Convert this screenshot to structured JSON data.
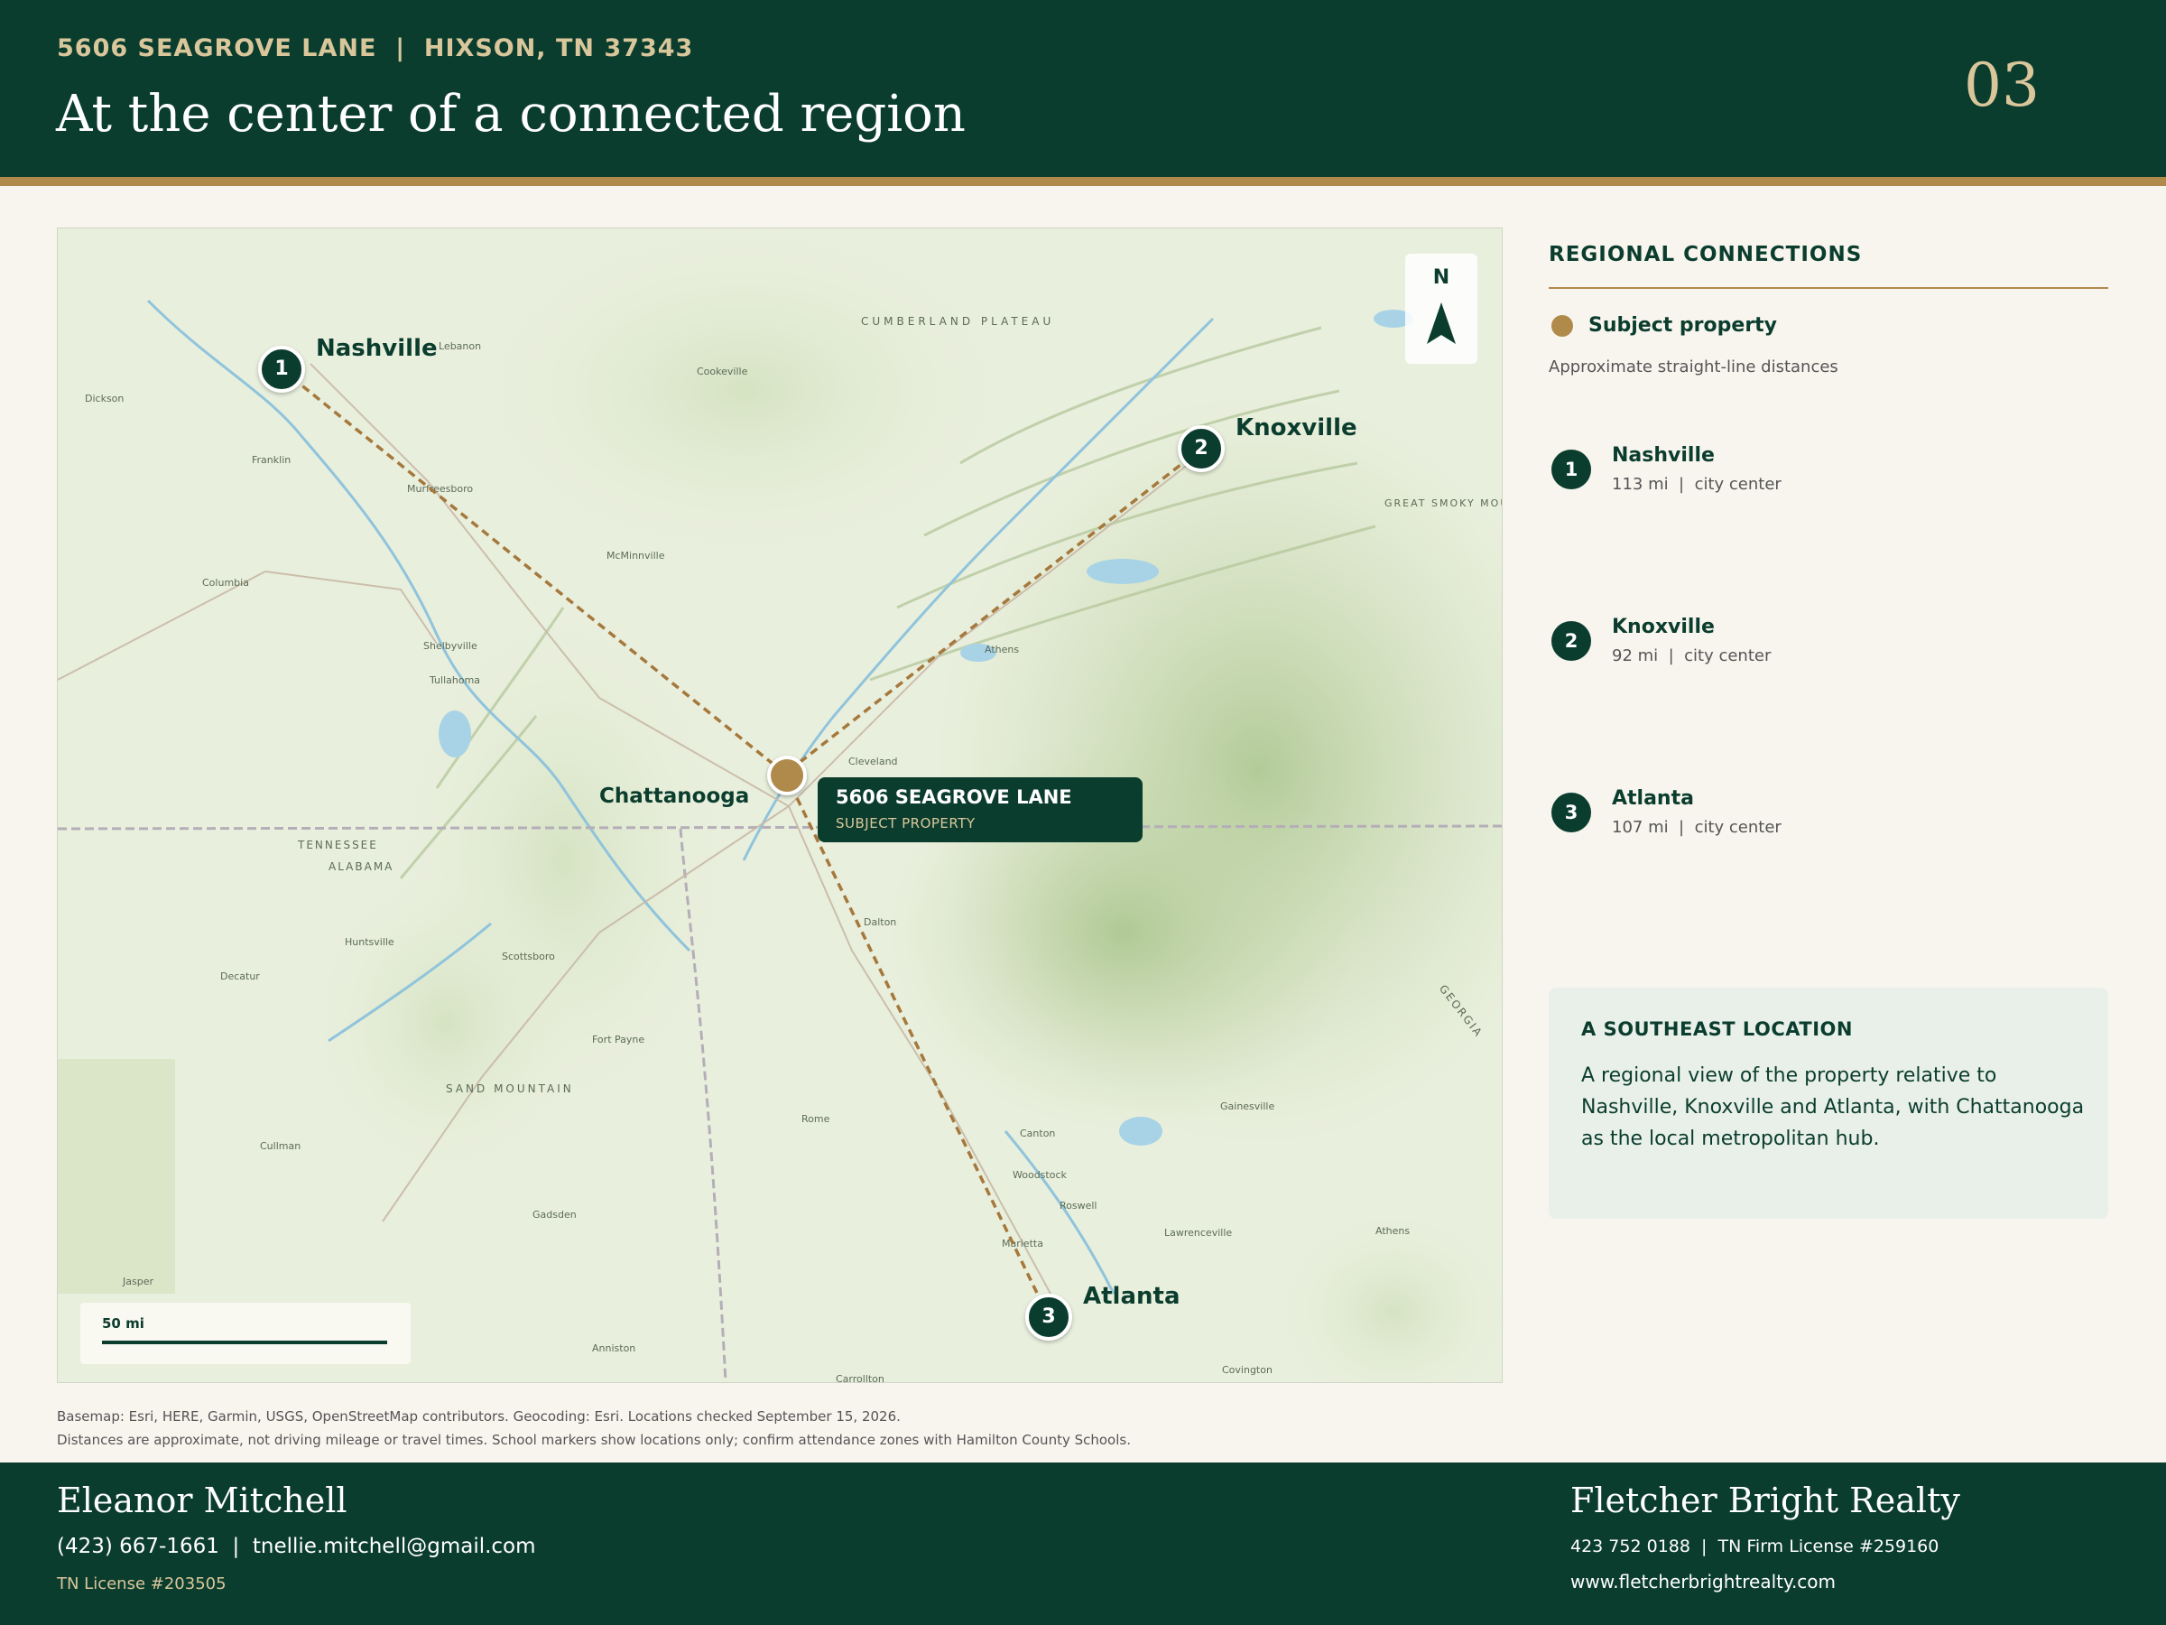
{
  "header": {
    "address": "5606 SEAGROVE LANE  |  HIXSON, TN 37343",
    "title": "At the center of a connected region",
    "page_number": "03"
  },
  "map": {
    "compass_label": "N",
    "scale_label": "50 mi",
    "subject": {
      "city_label": "Chattanooga",
      "callout_title": "5606 SEAGROVE LANE",
      "callout_subtitle": "SUBJECT PROPERTY"
    },
    "cities": [
      {
        "number": "1",
        "name": "Nashville"
      },
      {
        "number": "2",
        "name": "Knoxville"
      },
      {
        "number": "3",
        "name": "Atlanta"
      }
    ],
    "basemap_labels": {
      "tennessee": "TENNESSEE",
      "alabama": "ALABAMA",
      "georgia": "GEORGIA",
      "cumberland_plateau": "CUMBERLAND PLATEAU",
      "sand_mountain": "SAND MOUNTAIN",
      "great_smoky_mountains": "GREAT SMOKY MOUNTAINS",
      "cleveland": "Cleveland",
      "dalton": "Dalton",
      "rome": "Rome",
      "gadsden": "Gadsden",
      "huntsville": "Huntsville",
      "decatur": "Decatur",
      "murfreesboro": "Murfreesboro",
      "franklin": "Franklin",
      "columbia": "Columbia",
      "cookeville": "Cookeville",
      "athens": "Athens",
      "mcminnville": "McMinnville",
      "shelbyville": "Shelbyville",
      "tullahoma": "Tullahoma",
      "scottsboro": "Scottsboro",
      "fort_payne": "Fort Payne",
      "marietta": "Marietta",
      "canton": "Canton",
      "gainesville": "Gainesville",
      "lawrenceville": "Lawrenceville",
      "dickson": "Dickson",
      "lebanon": "Lebanon",
      "cullman": "Cullman",
      "anniston": "Anniston",
      "carrollton": "Carrollton",
      "covington": "Covington",
      "woodstock": "Woodstock",
      "roswell": "Roswell",
      "jasper": "Jasper",
      "athens_ga": "Athens"
    }
  },
  "credits": {
    "line1": "Basemap: Esri, HERE, Garmin, USGS, OpenStreetMap contributors. Geocoding: Esri. Locations checked September 15, 2026.",
    "line2": "Distances are approximate, not driving mileage or travel times. School markers show locations only; confirm attendance zones with Hamilton County Schools."
  },
  "panel": {
    "heading": "REGIONAL CONNECTIONS",
    "legend_label": "Subject property",
    "legend_note": "Approximate straight-line distances",
    "destinations": [
      {
        "number": "1",
        "name": "Nashville",
        "detail": "113 mi  |  city center"
      },
      {
        "number": "2",
        "name": "Knoxville",
        "detail": "92 mi  |  city center"
      },
      {
        "number": "3",
        "name": "Atlanta",
        "detail": "107 mi  |  city center"
      }
    ],
    "info": {
      "title": "A SOUTHEAST LOCATION",
      "body": "A regional view of the property relative to Nashville, Knoxville and Atlanta, with Chattanooga as the local metropolitan hub."
    }
  },
  "footer": {
    "agent_name": "Eleanor Mitchell",
    "agent_contact": "(423) 667-1661  |  tnellie.mitchell@gmail.com",
    "agent_license": "TN License #203505",
    "brokerage": "Fletcher Bright Realty",
    "brokerage_line": "423 752 0188  |  TN Firm License #259160",
    "brokerage_web": "www.fletcherbrightrealty.com"
  },
  "colors": {
    "brand_green": "#0b3d2e",
    "accent_gold": "#b08a4a",
    "cream": "#f8f5ef"
  }
}
